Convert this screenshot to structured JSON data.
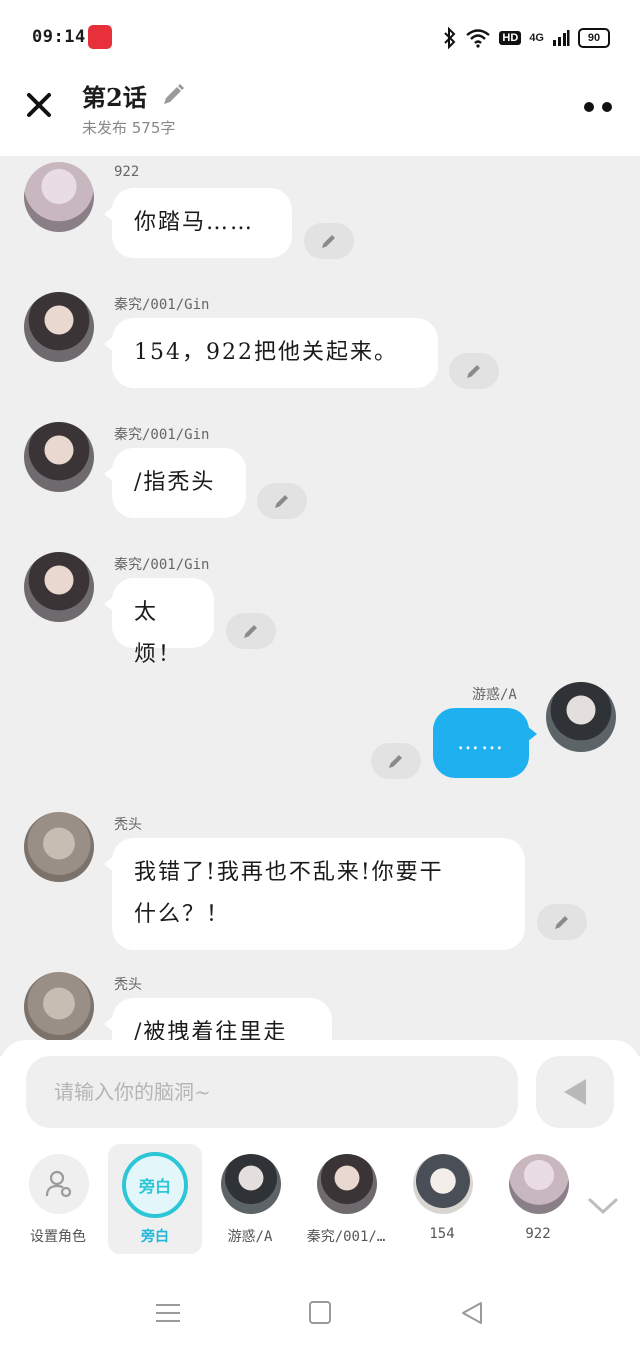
{
  "status_bar": {
    "time": "09:14",
    "network": "4G",
    "hd": "HD",
    "battery": "90"
  },
  "header": {
    "title": "第2话",
    "subtitle": "未发布 575字"
  },
  "messages": [
    {
      "sender": "922",
      "text": "你踏马……",
      "side": "left",
      "avatar_tone": "#c9b7c0"
    },
    {
      "sender": "秦究/001/Gin",
      "text": "154，922把他关起来。",
      "side": "left",
      "avatar_tone": "#6e6a6e"
    },
    {
      "sender": "秦究/001/Gin",
      "text": "/指秃头",
      "side": "left",
      "avatar_tone": "#6e6a6e"
    },
    {
      "sender": "秦究/001/Gin",
      "text": "太烦！",
      "side": "left",
      "avatar_tone": "#6e6a6e"
    },
    {
      "sender": "游惑/A",
      "text": "……",
      "side": "right",
      "avatar_tone": "#5d6468"
    },
    {
      "sender": "秃头",
      "text_line1": "我错了!我再也不乱来!你要干",
      "text_line2": "什么？！",
      "side": "left",
      "avatar_tone": "#9a8f86"
    },
    {
      "sender": "秃头",
      "text": "/被拽着往里走",
      "side": "left",
      "avatar_tone": "#9a8f86"
    }
  ],
  "composer": {
    "placeholder": "请输入你的脑洞~"
  },
  "roles": [
    {
      "label": "设置角色",
      "icon": "person-settings-icon"
    },
    {
      "label": "旁白",
      "badge": "旁白",
      "active": true
    },
    {
      "label": "游惑/A"
    },
    {
      "label": "秦究/001/…"
    },
    {
      "label": "154"
    },
    {
      "label": "922"
    }
  ],
  "colors": {
    "accent": "#1fb0f0",
    "narrator": "#2cc6d6",
    "chat_bg": "#efefef"
  }
}
